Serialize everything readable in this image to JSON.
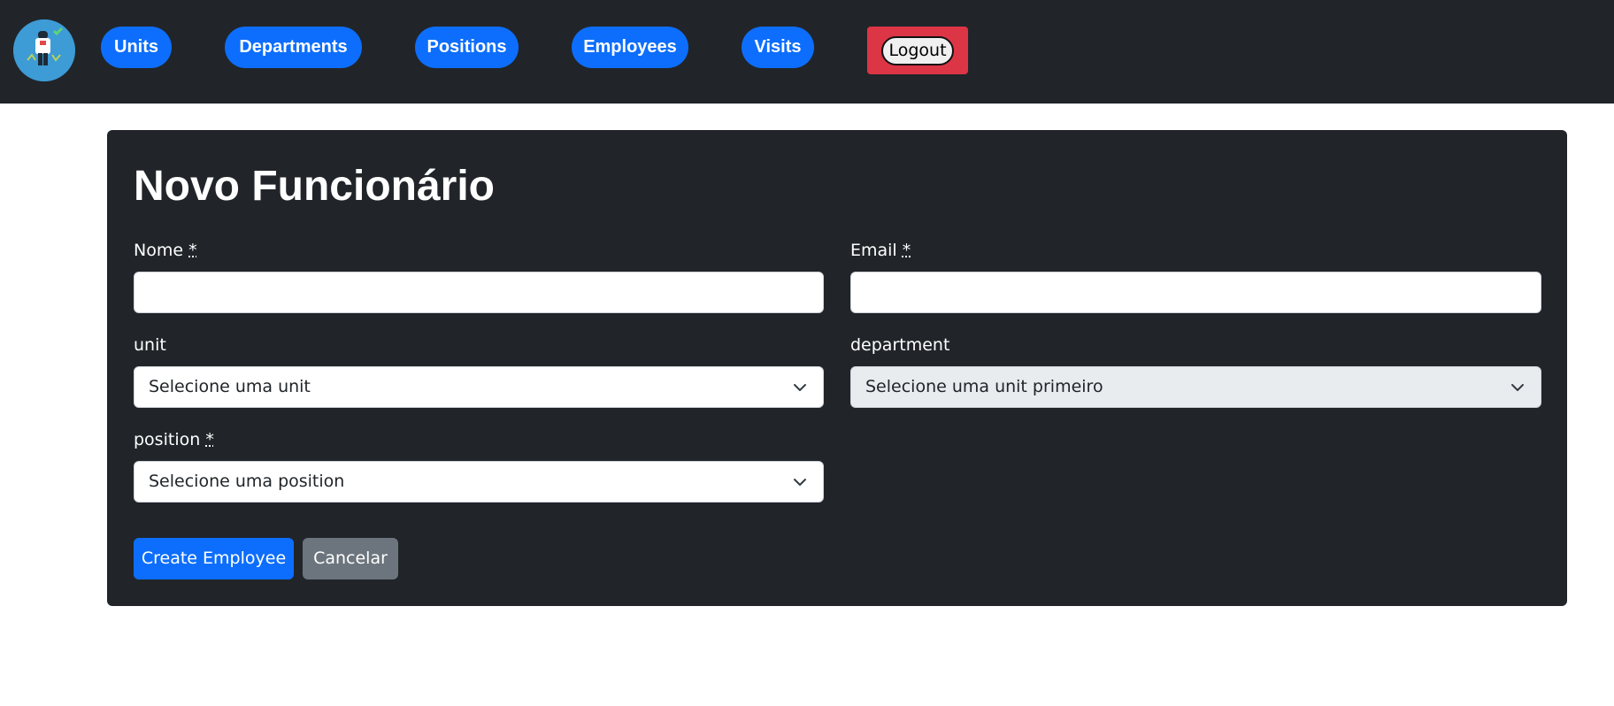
{
  "nav": {
    "logo_icon": "security-guard-logo-icon",
    "items": [
      {
        "label": "Units"
      },
      {
        "label": "Departments"
      },
      {
        "label": "Positions"
      },
      {
        "label": "Employees"
      },
      {
        "label": "Visits"
      }
    ],
    "logout_label": "Logout"
  },
  "form": {
    "title": "Novo Funcionário",
    "required_marker": "*",
    "fields": {
      "name": {
        "label": "Nome",
        "value": "",
        "placeholder": ""
      },
      "email": {
        "label": "Email",
        "value": "",
        "placeholder": ""
      },
      "unit": {
        "label": "unit",
        "selected": "Selecione uma unit"
      },
      "department": {
        "label": "department",
        "selected": "Selecione uma unit primeiro",
        "disabled": true
      },
      "position": {
        "label": "position",
        "selected": "Selecione uma position"
      }
    },
    "submit_label": "Create Employee",
    "cancel_label": "Cancelar"
  },
  "colors": {
    "navbar_bg": "#212529",
    "primary": "#0d6efd",
    "danger": "#dc3545",
    "secondary": "#6c757d",
    "card_bg": "#212529",
    "disabled_select_bg": "#e9ecef"
  }
}
